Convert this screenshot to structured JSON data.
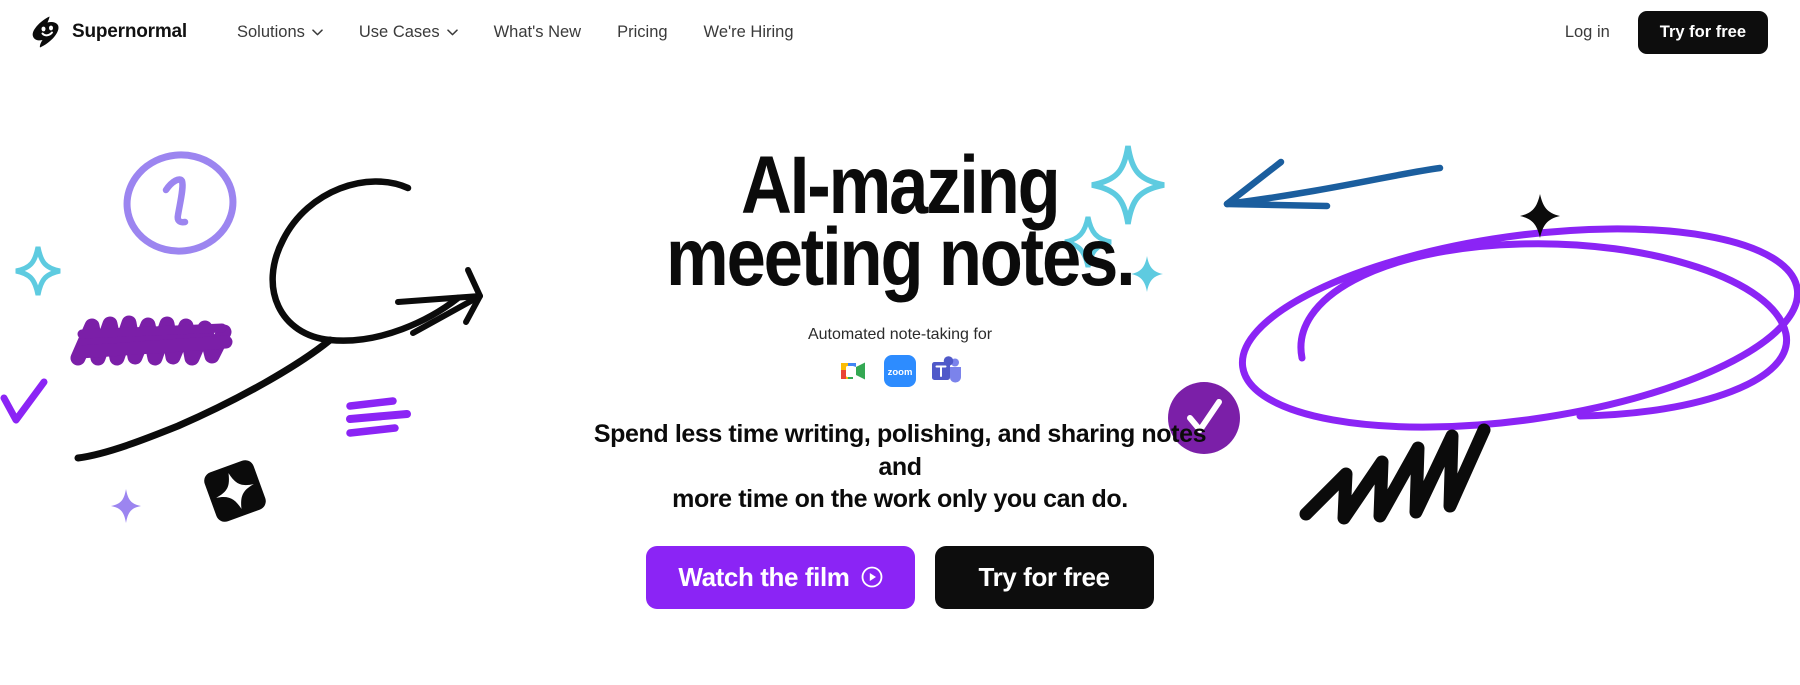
{
  "brand": {
    "name": "Supernormal",
    "logo_icon": "lightning-bolt-smiley-icon"
  },
  "nav": {
    "items": [
      {
        "label": "Solutions",
        "has_dropdown": true,
        "icon": "chevron-down-icon"
      },
      {
        "label": "Use Cases",
        "has_dropdown": true,
        "icon": "chevron-down-icon"
      },
      {
        "label": "What's New",
        "has_dropdown": false,
        "icon": ""
      },
      {
        "label": "Pricing",
        "has_dropdown": false,
        "icon": ""
      },
      {
        "label": "We're Hiring",
        "has_dropdown": false,
        "icon": ""
      }
    ],
    "login_label": "Log in",
    "cta_label": "Try for free"
  },
  "hero": {
    "headline_line_1": "AI-mazing",
    "headline_line_2": "meeting notes.",
    "eyebrow": "Automated note-taking for",
    "integrations": [
      {
        "name": "google-meet-icon",
        "label": "Google Meet"
      },
      {
        "name": "zoom-icon",
        "label": "Zoom",
        "wordmark": "zoom"
      },
      {
        "name": "microsoft-teams-icon",
        "label": "Microsoft Teams",
        "wordmark": "T"
      }
    ],
    "subcopy_line_1": "Spend less time writing, polishing, and sharing notes and",
    "subcopy_line_2": "more time on the work only you can do.",
    "primary_cta": {
      "label": "Watch the film",
      "icon": "play-circle-icon"
    },
    "secondary_cta": {
      "label": "Try for free"
    }
  },
  "decorations": {
    "left": [
      "circled-number-one-doodle",
      "purple-scribble-doodle",
      "black-loop-arrow-doodle",
      "cyan-sparkle-doodle",
      "purple-check-doodle",
      "purple-three-lines-doodle",
      "black-diamond-sparkle-doodle",
      "small-purple-sparkle-doodle"
    ],
    "right": [
      "cyan-sparkle-large-doodle",
      "cyan-sparkle-medium-doodle",
      "cyan-sparkle-small-doodle",
      "blue-arrow-doodle",
      "purple-double-oval-doodle",
      "purple-check-circle-doodle",
      "black-zigzag-scribble-doodle",
      "black-four-point-star-doodle"
    ]
  },
  "colors": {
    "brand_purple": "#8B24F5",
    "deep_purple": "#7B1FA8",
    "light_purple": "#9C85F0",
    "cyan": "#5ECBE0",
    "blue": "#1B5E9E",
    "black": "#0d0d0d",
    "white": "#ffffff",
    "text_gray": "#3a3a3a"
  }
}
